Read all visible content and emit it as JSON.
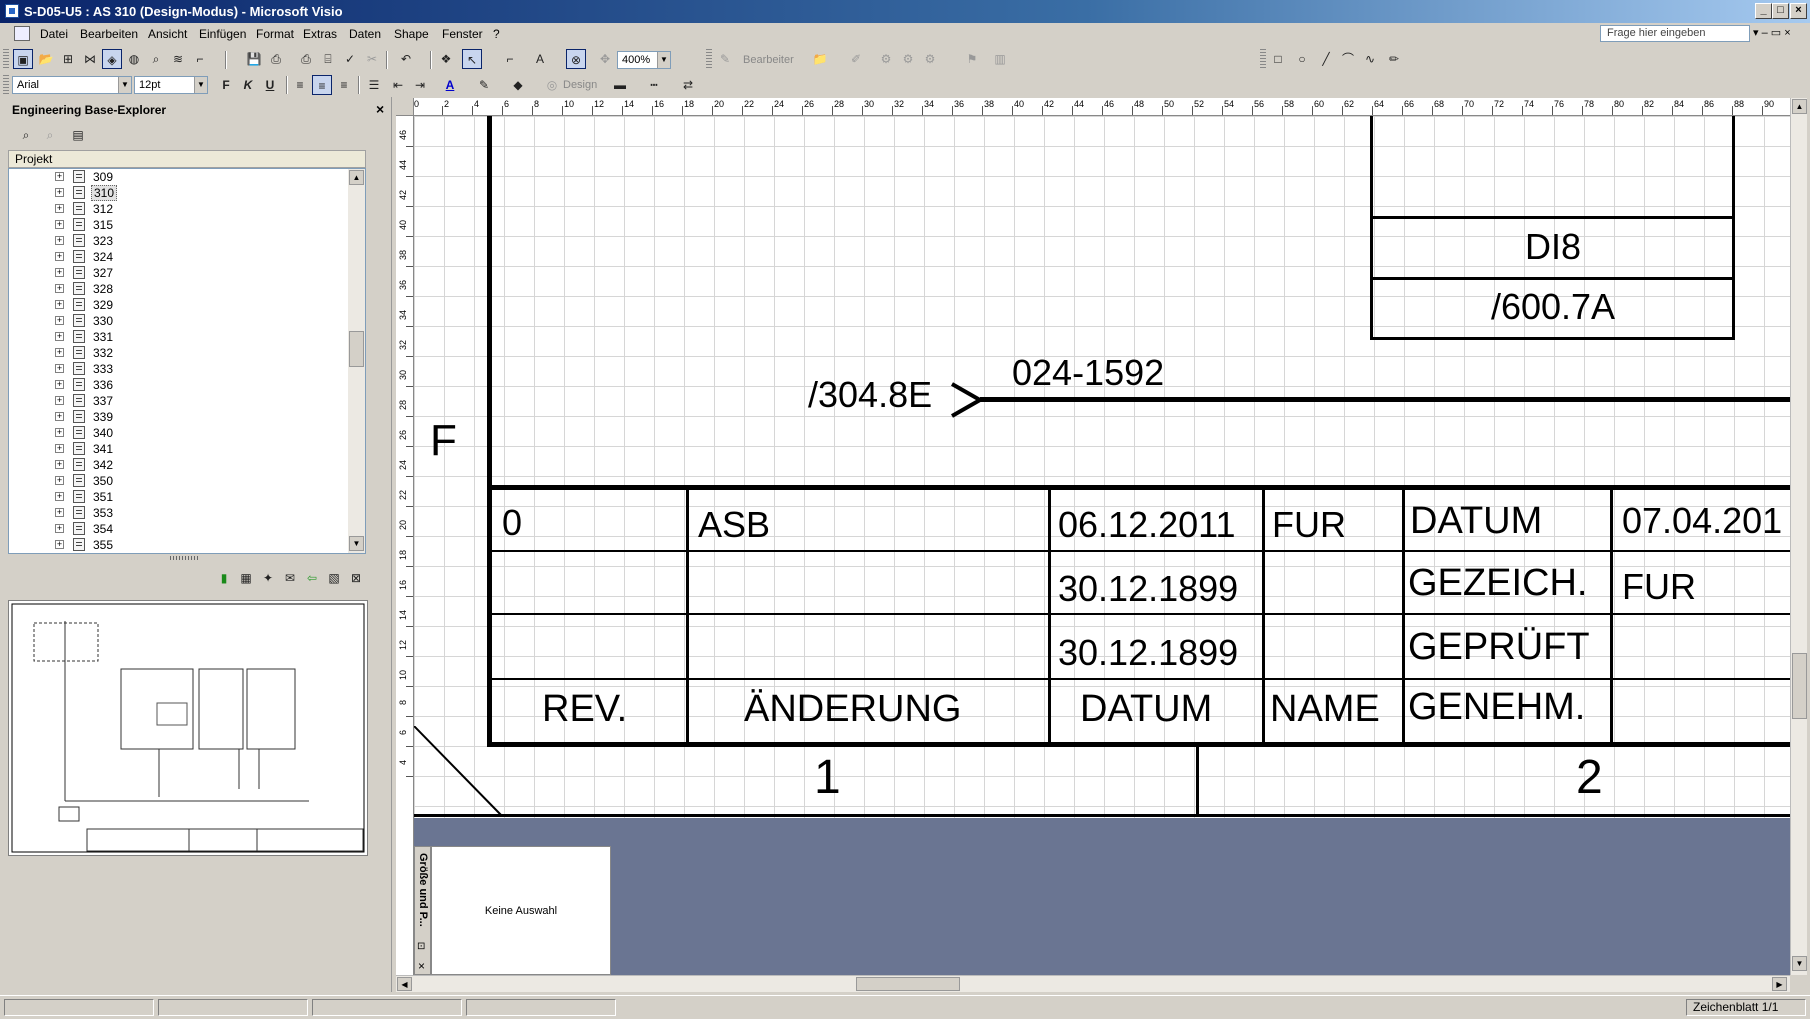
{
  "window": {
    "title": "S-D05-U5 : AS 310 (Design-Modus) - Microsoft Visio"
  },
  "menu": {
    "items": [
      "Datei",
      "Bearbeiten",
      "Ansicht",
      "Einfügen",
      "Format",
      "Extras",
      "Daten",
      "Shape",
      "Fenster",
      "?"
    ],
    "help_placeholder": "Frage hier eingeben"
  },
  "toolbar": {
    "zoom": "400%",
    "font": "Arial",
    "size": "12pt",
    "bearbeiter": "Bearbeiter",
    "design": "Design",
    "bold": "F",
    "italic": "K",
    "underline": "U"
  },
  "explorer": {
    "title": "Engineering Base-Explorer",
    "close": "×",
    "column_header": "Projekt",
    "items": [
      "309",
      "310",
      "312",
      "315",
      "323",
      "324",
      "327",
      "328",
      "329",
      "330",
      "331",
      "332",
      "333",
      "336",
      "337",
      "339",
      "340",
      "341",
      "342",
      "350",
      "351",
      "353",
      "354",
      "355"
    ],
    "selected": "310"
  },
  "ruler_top": [
    "0",
    "2",
    "4",
    "6",
    "8",
    "10",
    "12",
    "14",
    "16",
    "18",
    "20",
    "22",
    "24",
    "26",
    "28",
    "30",
    "32",
    "34",
    "36",
    "38",
    "40",
    "42",
    "44",
    "46",
    "48",
    "50",
    "52",
    "54",
    "56",
    "58",
    "60",
    "62",
    "64",
    "66",
    "68",
    "70",
    "72",
    "74",
    "76",
    "78",
    "80",
    "82",
    "84",
    "86",
    "88",
    "90"
  ],
  "ruler_left": [
    "46",
    "44",
    "42",
    "40",
    "38",
    "36",
    "34",
    "32",
    "30",
    "28",
    "26",
    "24",
    "22",
    "20",
    "18",
    "16",
    "14",
    "12",
    "10",
    "8",
    "6",
    "4"
  ],
  "drawing": {
    "row_letter": "F",
    "block_label": "DI8",
    "block_ref": "/600.7A",
    "signal_ref": "/304.8E",
    "wire_label": "024-1592",
    "titleblock": {
      "rows": [
        [
          "0",
          "ASB",
          "06.12.2011",
          "FUR",
          "DATUM",
          "07.04.201"
        ],
        [
          "",
          "",
          "30.12.1899",
          "",
          "GEZEICH.",
          "FUR"
        ],
        [
          "",
          "",
          "30.12.1899",
          "",
          "GEPRÜFT",
          ""
        ]
      ],
      "header": [
        "REV.",
        "ÄNDERUNG",
        "DATUM",
        "NAME",
        "GENEHM."
      ]
    },
    "col_numbers": [
      "1",
      "2"
    ]
  },
  "shapes_pane": {
    "label": "Größe und P...",
    "content": "Keine Auswahl"
  },
  "status": {
    "page": "Zeichenblatt 1/1"
  }
}
